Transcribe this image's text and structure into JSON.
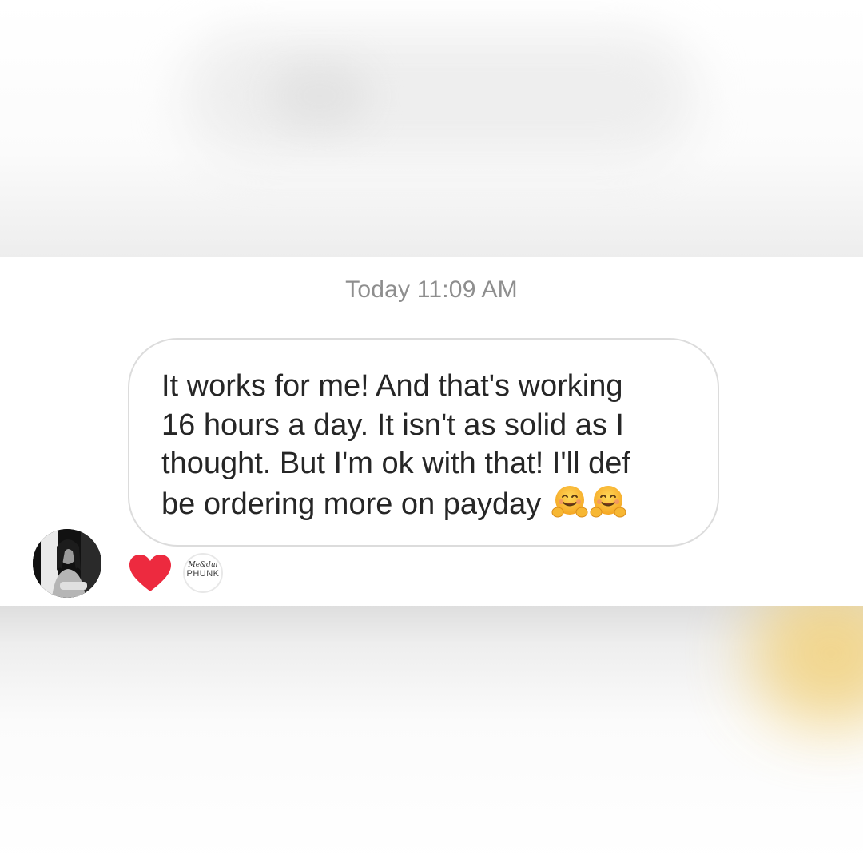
{
  "conversation": {
    "timestamp": "Today 11:09 AM",
    "message": {
      "text": "It works for me! And that's working\n16 hours a day. It isn't as solid as I\nthought. But I'm ok with that! I'll def\nbe ordering more on payday",
      "trailing_emoji": [
        "hugging-face",
        "hugging-face"
      ]
    },
    "reactions": [
      {
        "icon": "heart-icon",
        "color": "#ed2a3f"
      }
    ],
    "reaction_badge": {
      "script": "Me&dui",
      "word": "PHUNK"
    },
    "sender_avatar": {
      "style": "black-and-white photo"
    }
  },
  "colors": {
    "timestamp": "#8e8e8e",
    "text": "#262626",
    "bubble_border": "#dcdcdc",
    "heart": "#ed2a3f",
    "corner_glow": "#f2d27e"
  }
}
